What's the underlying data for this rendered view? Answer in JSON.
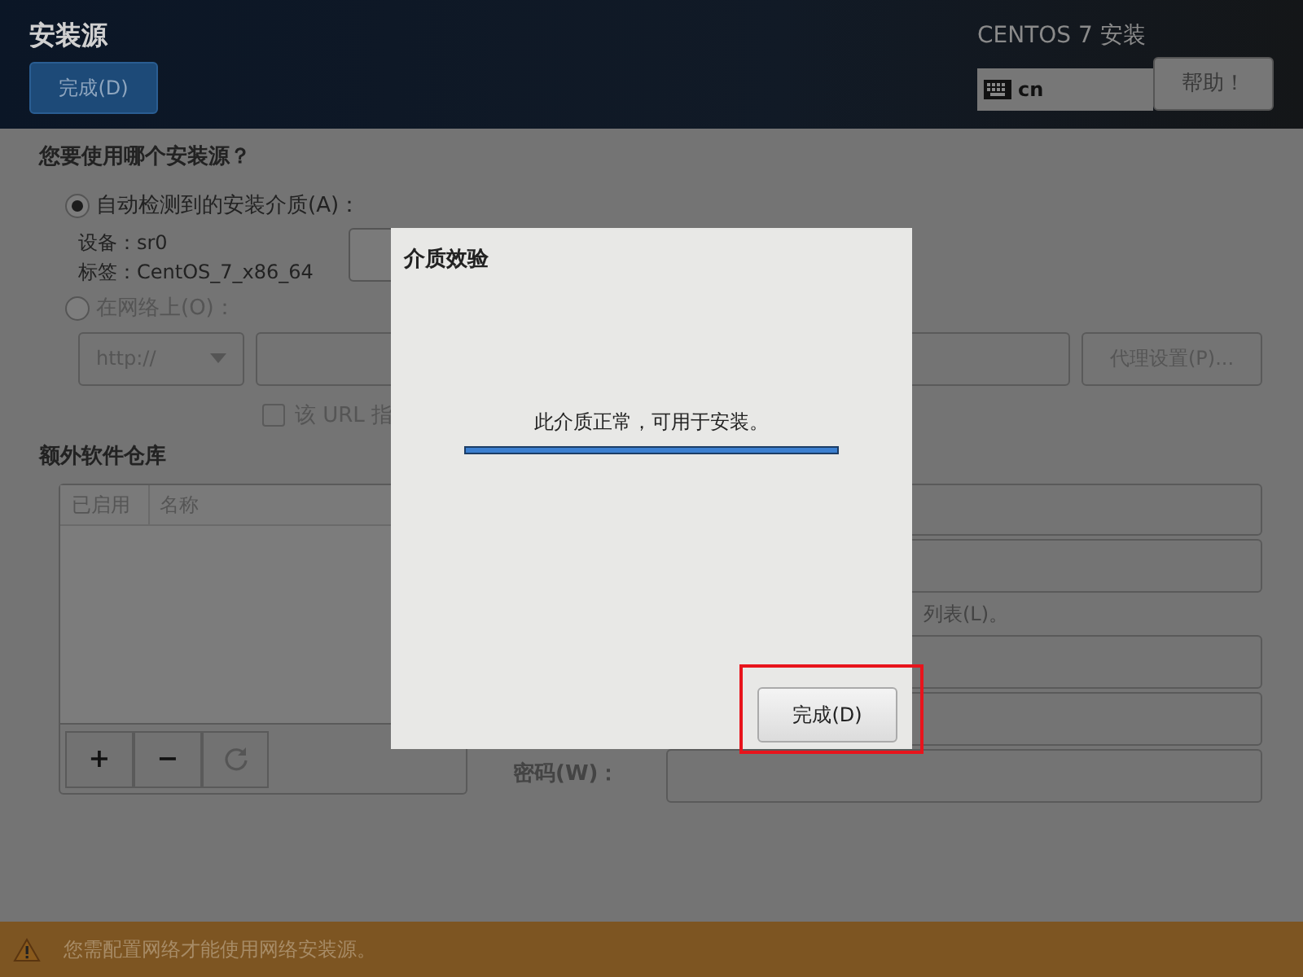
{
  "header": {
    "title": "安装源",
    "done_button": "完成(D)",
    "product": "CENTOS 7 安装",
    "keyboard_layout": "cn",
    "help_button": "帮助！"
  },
  "source": {
    "question": "您要使用哪个安装源？",
    "options": [
      {
        "label": "自动检测到的安装介质(A)：",
        "selected": true,
        "disabled": false
      },
      {
        "label": "在网络上(O)：",
        "selected": false,
        "disabled": true
      }
    ],
    "device": "设备：sr0",
    "media_label": "标签：CentOS_7_x86_64",
    "protocol": "http://",
    "proxy_button": "代理设置(P)...",
    "url_checkbox": {
      "label": "该 URL 指",
      "checked": false
    }
  },
  "repos": {
    "title": "额外软件仓库",
    "columns": [
      "已启用",
      "名称"
    ],
    "buttons": [
      "+",
      "−"
    ],
    "mirror_note": "列表(L)。",
    "password_label": "密码(W)："
  },
  "dialog": {
    "title": "介质效验",
    "message": "此介质正常，可用于安装。",
    "level": 1,
    "done_button": "完成(D)",
    "highlighted": true
  },
  "warning": "您需配置网络才能使用网络安装源。"
}
